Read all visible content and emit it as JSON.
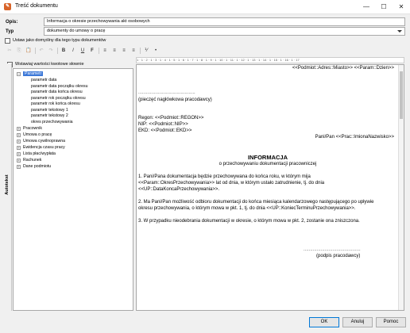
{
  "window": {
    "title": "Treść dokumentu",
    "minimize": "—",
    "maximize": "☐",
    "close": "✕"
  },
  "form": {
    "opis_label": "Opis:",
    "opis_value": "Informacja o okresie przechowywania akt osobowych",
    "typ_label": "Typ",
    "typ_value": "dokumenty do umowy o pracę",
    "default_checkbox_label": "Ustaw jako domyślny dla tego typu dokumentów",
    "insert_checkbox_label": "Wstawiaj wartości kwotowe słownie"
  },
  "toolbar": {
    "cut": "✂",
    "copy": "⎘",
    "paste": "📋",
    "undo": "↶",
    "redo": "↷",
    "bold": "B",
    "italic": "I",
    "underline": "U",
    "font": "F",
    "align_left": "≡",
    "align_center": "≡",
    "align_right": "≡",
    "justify": "≡",
    "ordered_list": "⅟",
    "unordered_list": "•"
  },
  "side_tab_label": "Autotekst",
  "tree": {
    "root": "Parametr",
    "children": [
      "parametr data",
      "parametr data początku okresu",
      "parametr data końca okresu",
      "parametr rok początku okresu",
      "parametr rok końca okresu",
      "parametr tekstowy 1",
      "parametr tekstowy 2",
      "okres przechowywania"
    ],
    "groups": [
      "Pracownik",
      "Umowa o pracę",
      "Umowa cywilnoprawna",
      "Ewidencja czasu pracy",
      "Lista płac/wypłata",
      "Rachunek",
      "Dane podmiotu"
    ]
  },
  "ruler": "1 · 1 · 2 · 1 · 3 · 1 · 4 · 1 · 5 · 1 · 6 · 1 · 7 · 1 · 8 · 1 · 9 · 1 · 10 · 1 · 11 · 1 · 12 · 1 · 13 · 1 · 14 · 1 · 15 · 1 · 16 · 1 · 17",
  "document": {
    "place_date": "<<Podmiot::Adres::Miasto>> <<Param::Dzien>>",
    "dots1": "...........................................",
    "stamp": "(pieczęć nagłówkowa pracodawcy)",
    "regon": "Regon:  <<Podmiot::REGON>>",
    "nip": "NIP:      <<Podmiot::NIP>>",
    "ekd": "EKD:    <<Podmiot::EKD>>",
    "addressee": "Pani/Pan <<Prac::ImionaNazwisko>>",
    "heading": "INFORMACJA",
    "subheading": "o przechowywaniu dokumentacji pracowniczej",
    "p1_l1": "1. Pani/Pana dokumentacja będzie przechowywana do końca roku, w którym mija",
    "p1_l2": "<<Param::OkresPrzechowywania>> lat od dnia, w którym ustało zatrudnienie, tj. do dnia",
    "p1_l3": "<<UP::DataKoncaPrzechowywania>>.",
    "p2_l1": "2. Ma Pani/Pan możliwość odbioru dokumentacji do końca miesiąca kalendarzowego następującego po upływie",
    "p2_l2": "okresu przechowywania, o którym mowa w pkt. 1, tj. do dnia <<UP::KoniecTerminuPrzechowywania>>.",
    "p3_l1": "3. W przypadku nieodebrania dokumentacji w okresie, o którym mowa w pkt. 2, zostanie ona zniszczona.",
    "dots2": "...........................................",
    "signature": "(podpis pracodawcy)"
  },
  "buttons": {
    "ok": "OK",
    "cancel": "Anuluj",
    "help": "Pomoc"
  }
}
